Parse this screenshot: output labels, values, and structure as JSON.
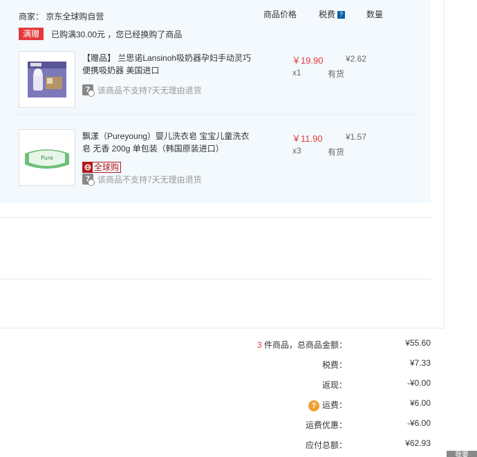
{
  "header": {
    "seller_label": "商家：",
    "seller_name": "京东全球购自营",
    "col_price": "商品价格",
    "col_tax": "税费",
    "col_tax_help": "?",
    "col_qty": "数量"
  },
  "promo": {
    "badge": "满赠",
    "text": "已购满30.00元 ，您已经换购了商品"
  },
  "items": [
    {
      "title": "【赠品】 兰思诺Lansinoh吸奶器孕妇手动灵巧便携吸奶器 美国进口",
      "price": "￥19.90",
      "tax": "¥2.62",
      "qty": "x1",
      "stock": "有货",
      "return_badge": "7",
      "return_note": "该商品不支持7天无理由退货"
    },
    {
      "title": "飘漾（Pureyoung）婴儿洗衣皂 宝宝儿童洗衣皂 无香 200g 单包装（韩国原装进口）",
      "price": "￥11.90",
      "tax": "¥1.57",
      "qty": "x3",
      "stock": "有货",
      "global_tag": "全球购",
      "return_badge": "7",
      "return_note": "该商品不支持7天无理由退货"
    }
  ],
  "summary": {
    "count": "3",
    "count_suffix": " 件商品，总商品金额：",
    "subtotal": "¥55.60",
    "tax_label": "税费：",
    "tax": "¥7.33",
    "cashback_label": "返现：",
    "cashback": "-¥0.00",
    "shipping_help": "?",
    "shipping_label": "运费：",
    "shipping": "¥6.00",
    "shipping_discount_label": "运费优惠：",
    "shipping_discount": "-¥6.00",
    "total_label": "应付总额：",
    "total": "¥62.93"
  },
  "corner_button": "我要",
  "colors": {
    "accent": "#e4393c",
    "panel_bg": "#f3f9fd",
    "global": "#b1191a"
  }
}
